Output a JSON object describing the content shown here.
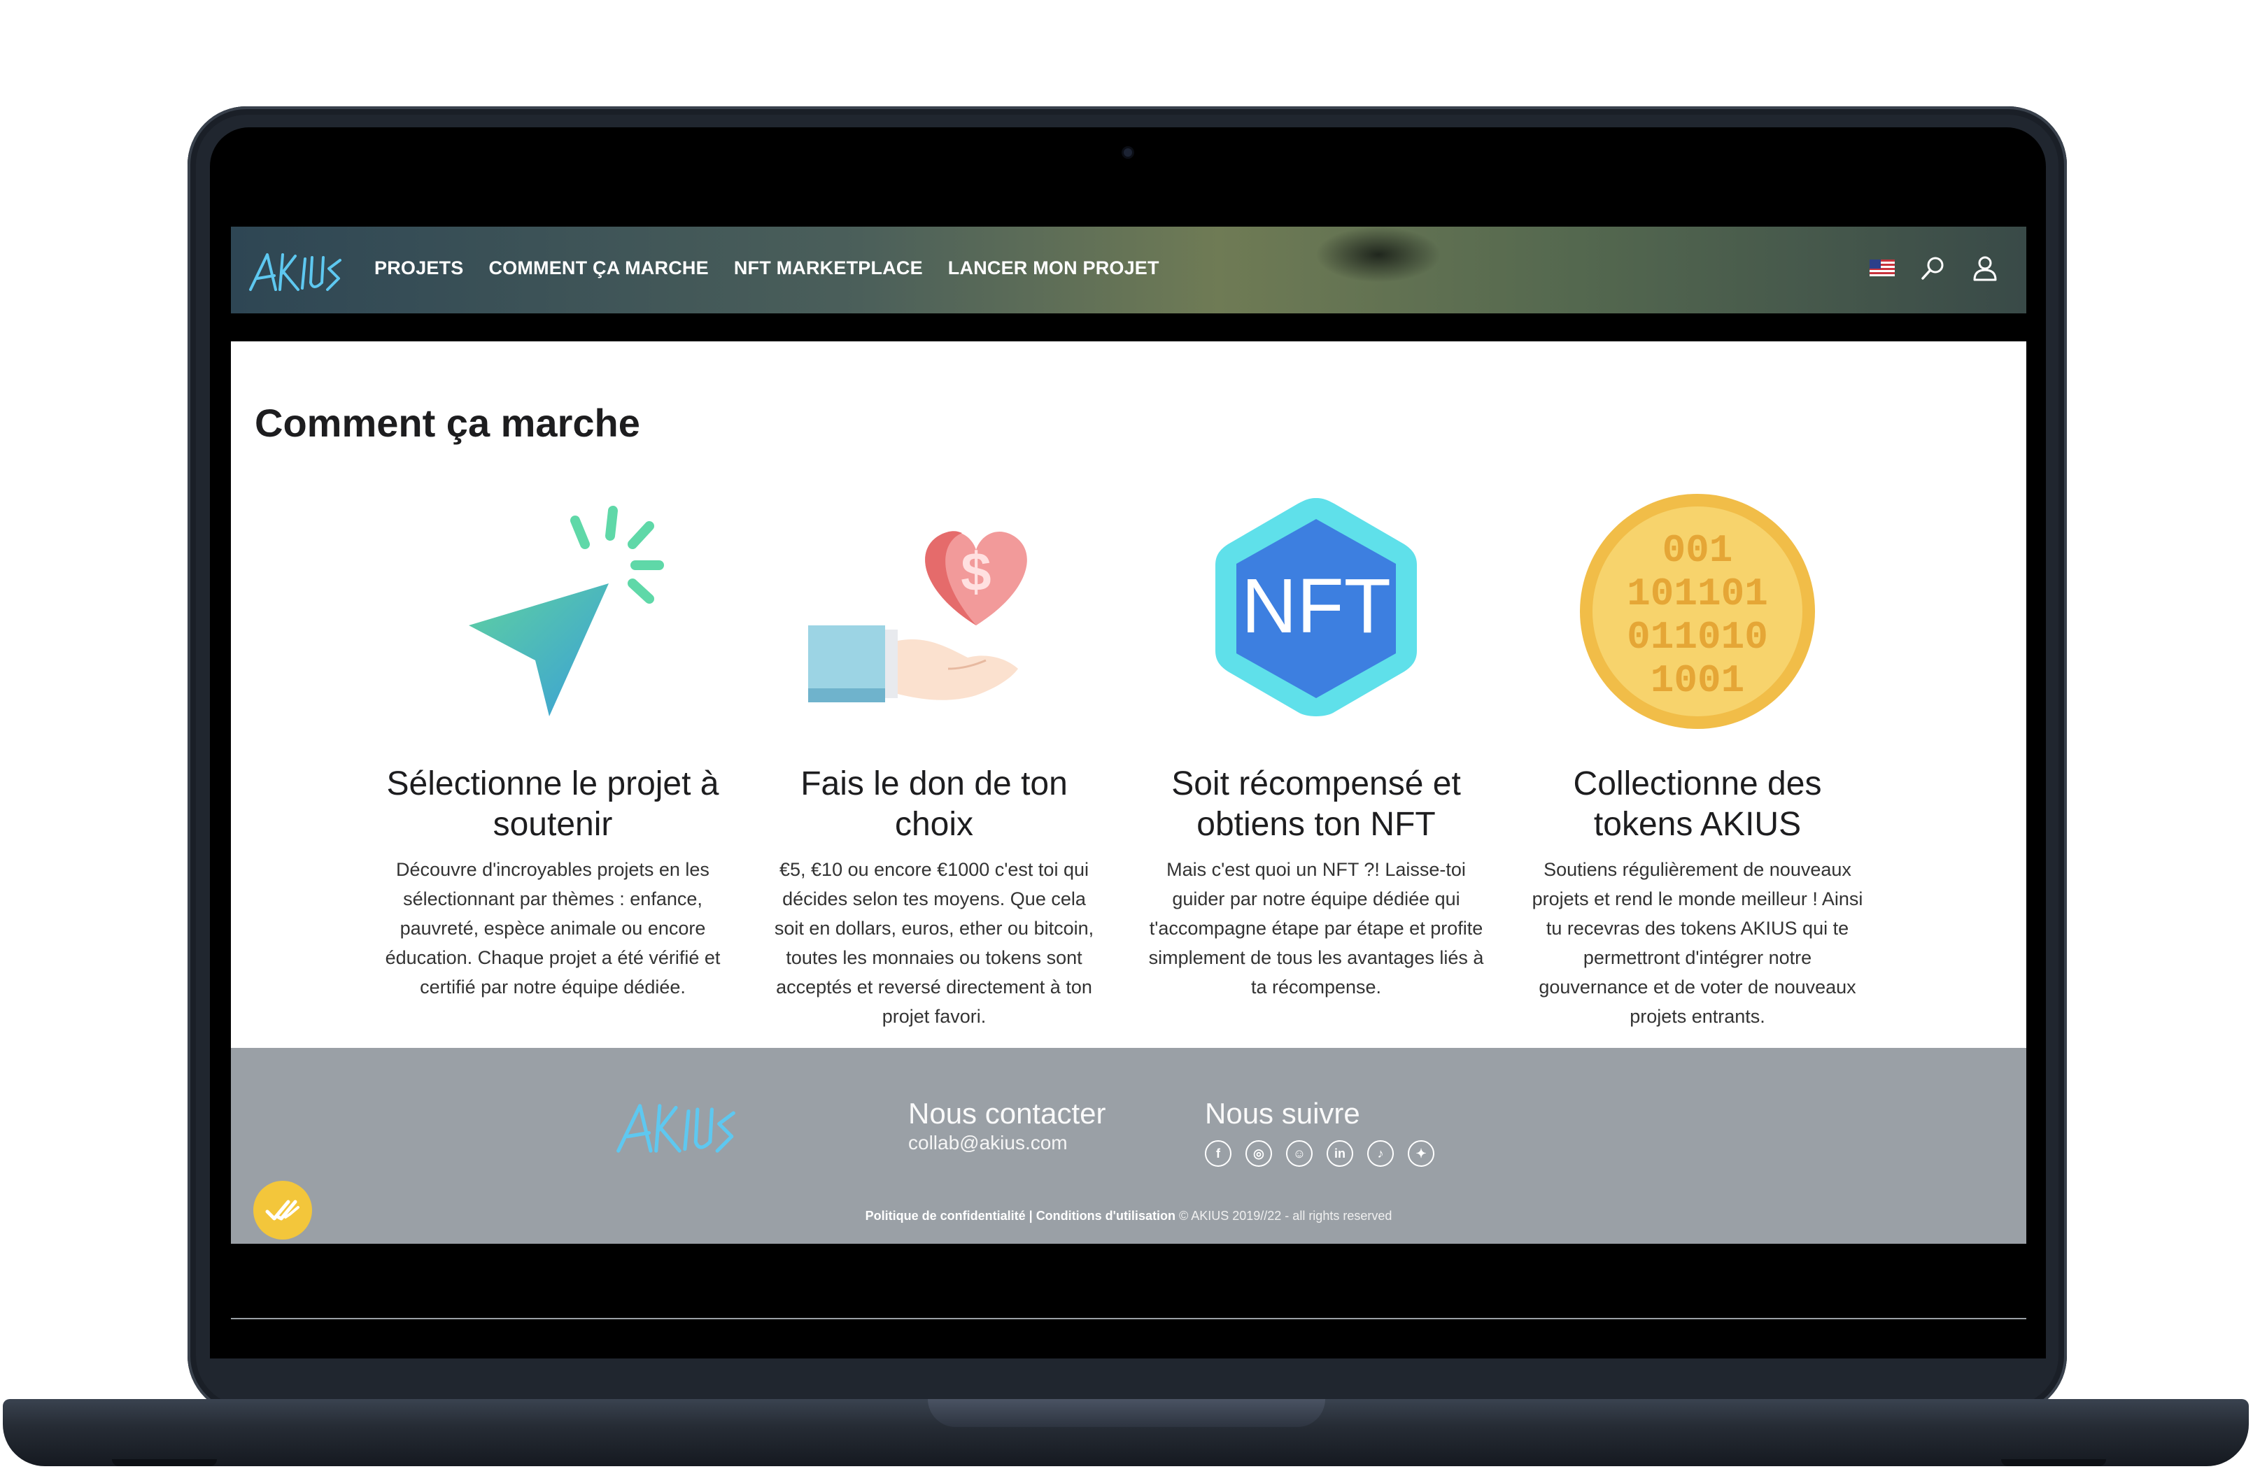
{
  "nav": {
    "brand": "AKIUS",
    "links": [
      "PROJETS",
      "COMMENT ÇA MARCHE",
      "NFT MARKETPLACE",
      "LANCER MON PROJET"
    ],
    "icons": [
      "us-flag-icon",
      "search-icon",
      "user-icon"
    ]
  },
  "page": {
    "title": "Comment ça marche"
  },
  "steps": [
    {
      "icon": "cursor-click-icon",
      "title": "Sélectionne le projet à soutenir",
      "text": "Découvre d'incroyables projets en les sélectionnant par thèmes : enfance, pauvreté, espèce animale ou encore éducation. Chaque projet a été vérifié et certifié par notre équipe dédiée."
    },
    {
      "icon": "donation-heart-icon",
      "title": "Fais le don de ton choix",
      "text": "€5, €10 ou encore €1000 c'est toi qui décides selon tes moyens. Que cela soit en dollars, euros, ether ou bitcoin, toutes les monnaies ou tokens sont acceptés et reversé directement à ton projet favori."
    },
    {
      "icon": "nft-hexagon-icon",
      "title": "Soit récompensé et obtiens ton NFT",
      "text": "Mais c'est quoi un NFT ?! Laisse-toi guider par notre équipe dédiée qui t'accompagne étape par étape et profite simplement de tous les avantages liés à ta récompense."
    },
    {
      "icon": "binary-coin-icon",
      "title": "Collectionne des tokens AKIUS",
      "text": "Soutiens régulièrement de nouveaux projets et rend le monde meilleur ! Ainsi tu recevras des tokens AKIUS qui te permettront d'intégrer notre gouvernance et de voter de nouveaux projets entrants."
    }
  ],
  "footer": {
    "brand": "AKIUS",
    "contact_heading": "Nous contacter",
    "contact_email": "collab@akius.com",
    "follow_heading": "Nous suivre",
    "socials": [
      {
        "name": "facebook-icon",
        "glyph": "f"
      },
      {
        "name": "instagram-icon",
        "glyph": "◎"
      },
      {
        "name": "snapchat-icon",
        "glyph": "☺"
      },
      {
        "name": "linkedin-icon",
        "glyph": "in"
      },
      {
        "name": "tiktok-icon",
        "glyph": "♪"
      },
      {
        "name": "twitter-icon",
        "glyph": "✦"
      }
    ],
    "privacy_link": "Politique de confidentialité",
    "separator": " | ",
    "terms_link": "Conditions d'utilisation",
    "copyright": " © AKIUS 2019//22 - all rights reserved"
  },
  "colors": {
    "footer_bg": "#9aa0a6",
    "coin": "#f3c63b",
    "nft_blue": "#3d7fe0",
    "nft_cyan": "#5fe0ea",
    "badge": "#f3c63b"
  }
}
